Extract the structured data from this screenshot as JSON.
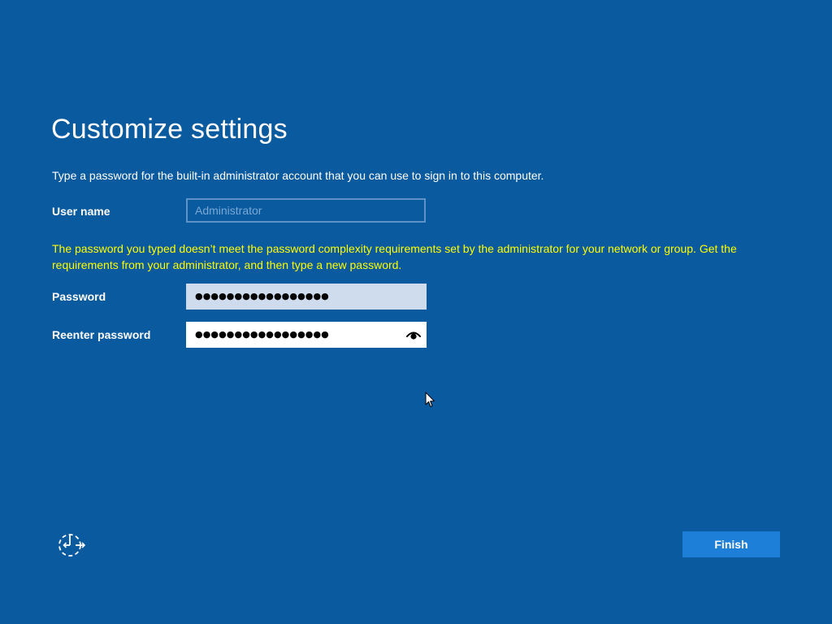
{
  "page": {
    "title": "Customize settings",
    "description": "Type a password for the built-in administrator account that you can use to sign in to this computer."
  },
  "user_name": {
    "label": "User name",
    "placeholder": "Administrator",
    "value": ""
  },
  "warning": "The password you typed doesn’t meet the password complexity requirements set by the administrator for your network or group. Get the requirements from your administrator, and then type a new password.",
  "password": {
    "label": "Password",
    "masked_value": "●●●●●●●●●●●●●●●●●"
  },
  "reenter_password": {
    "label": "Reenter password",
    "masked_value": "●●●●●●●●●●●●●●●●●",
    "reveal_icon": "eye-icon"
  },
  "footer": {
    "ease_of_access_icon": "ease-of-access-icon",
    "finish_label": "Finish"
  },
  "colors": {
    "background": "#0a5aa0",
    "warning_text": "#ffff00",
    "finish_button": "#1e7fd8"
  }
}
